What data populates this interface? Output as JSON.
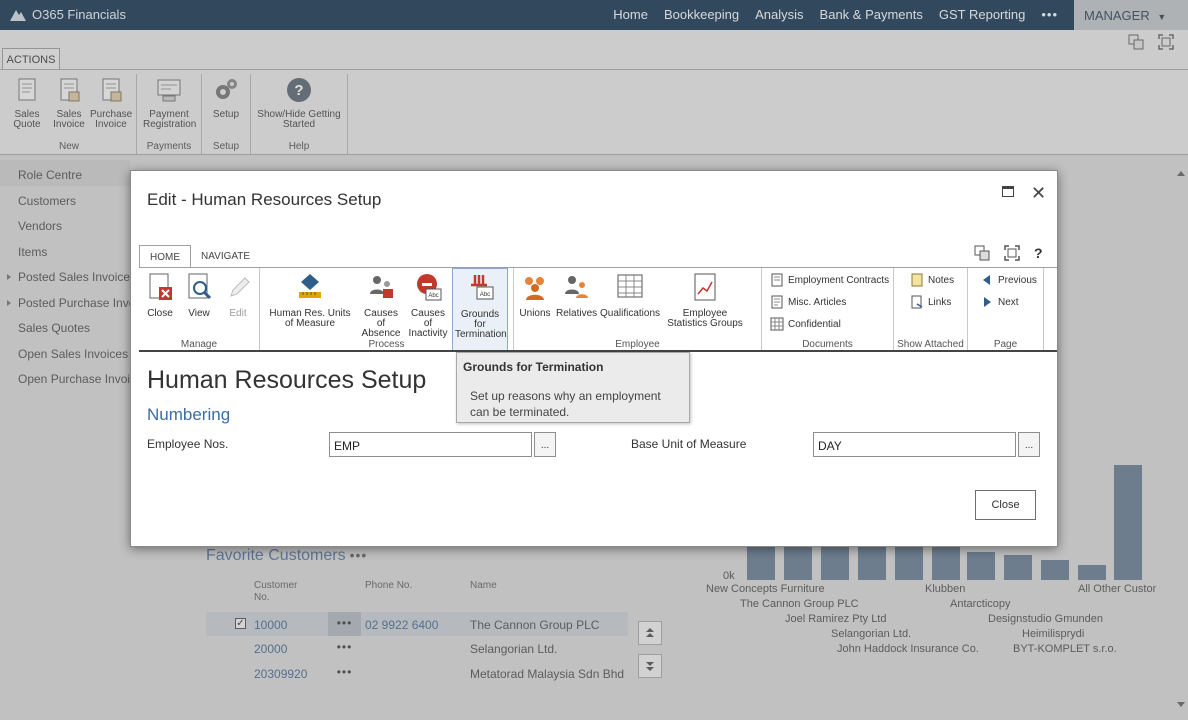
{
  "app": {
    "title": "O365 Financials",
    "nav": [
      "Home",
      "Bookkeeping",
      "Analysis",
      "Bank & Payments",
      "GST Reporting"
    ],
    "nav_more": "•••",
    "user": "MANAGER"
  },
  "bg_ribbon": {
    "tab": "ACTIONS",
    "groups": [
      {
        "label": "New",
        "buttons": [
          "Sales Quote",
          "Sales Invoice",
          "Purchase Invoice"
        ]
      },
      {
        "label": "Payments",
        "buttons": [
          "Payment Registration"
        ]
      },
      {
        "label": "Setup",
        "buttons": [
          "Setup"
        ]
      },
      {
        "label": "Help",
        "buttons": [
          "Show/Hide Getting Started"
        ]
      }
    ]
  },
  "sidebar": {
    "items": [
      "Role Centre",
      "Customers",
      "Vendors",
      "Items",
      "Posted Sales Invoices",
      "Posted Purchase Invoices",
      "Sales Quotes",
      "Open Sales Invoices",
      "Open Purchase Invoices"
    ]
  },
  "favorites": {
    "title": "Favorite Customers",
    "title_dots": "•••",
    "headers": {
      "no": "Customer No.",
      "phone": "Phone No.",
      "name": "Name"
    },
    "rows": [
      {
        "no": "10000",
        "phone": "02 9922 6400",
        "name": "The Cannon Group PLC"
      },
      {
        "no": "20000",
        "phone": "",
        "name": "Selangorian Ltd."
      },
      {
        "no": "20309920",
        "phone": "",
        "name": "Metatorad Malaysia Sdn Bhd"
      }
    ]
  },
  "chart": {
    "zero_label": "0k",
    "labels": [
      "New Concepts Furniture",
      "The Cannon Group PLC",
      "Joel Ramirez Pty Ltd",
      "Selangorian Ltd.",
      "John Haddock Insurance Co.",
      "Klubben",
      "Antarcticopy",
      "Designstudio Gmunden",
      "Heimilisprydi",
      "BYT-KOMPLET s.r.o.",
      "All Other Customers"
    ]
  },
  "dialog": {
    "title": "Edit - Human Resources Setup",
    "tabs": [
      "HOME",
      "NAVIGATE"
    ],
    "groups": {
      "manage": {
        "label": "Manage",
        "close": "Close",
        "view": "View",
        "edit": "Edit"
      },
      "process": {
        "label": "Process",
        "units": "Human Res. Units of Measure",
        "absence": "Causes of Absence",
        "inactivity": "Causes of Inactivity",
        "termination": "Grounds for Termination"
      },
      "employee": {
        "label": "Employee",
        "unions": "Unions",
        "relatives": "Relatives",
        "qualifications": "Qualifications",
        "stats": "Employee Statistics Groups"
      },
      "documents": {
        "label": "Documents",
        "contracts": "Employment Contracts",
        "articles": "Misc. Articles",
        "confidential": "Confidential"
      },
      "attached": {
        "label": "Show Attached",
        "notes": "Notes",
        "links": "Links"
      },
      "page": {
        "label": "Page",
        "previous": "Previous",
        "next": "Next"
      }
    },
    "tooltip": {
      "title": "Grounds for Termination",
      "body": "Set up reasons why an employment can be terminated."
    },
    "page_title": "Human Resources Setup",
    "section": "Numbering",
    "fields": {
      "employee_nos": {
        "label": "Employee Nos.",
        "value": "EMP"
      },
      "base_uom": {
        "label": "Base Unit of Measure",
        "value": "DAY"
      }
    },
    "lookup": "...",
    "close_button": "Close"
  }
}
